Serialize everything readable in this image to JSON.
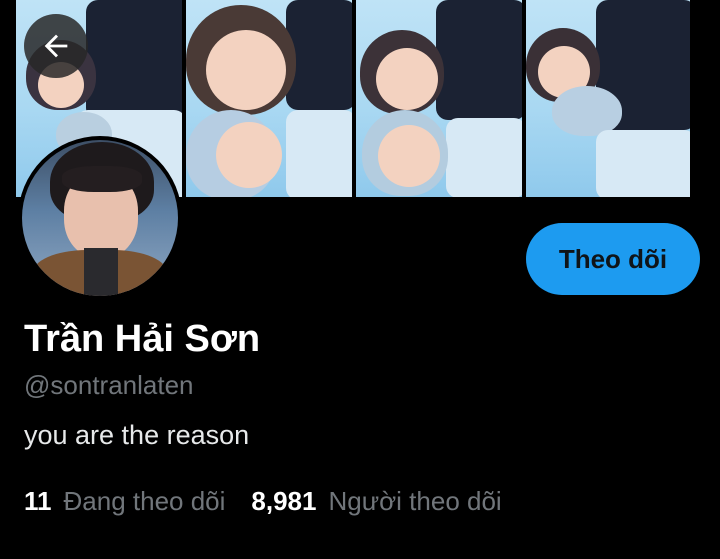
{
  "profile": {
    "name": "Trần Hải Sơn",
    "handle": "@sontranlaten",
    "bio": "you are the reason",
    "follow_label": "Theo dõi",
    "following_count": "11",
    "following_label": "Đang theo dõi",
    "followers_count": "8,981",
    "followers_label": "Người theo dõi"
  },
  "icons": {
    "back": "arrow-left-icon"
  },
  "colors": {
    "background": "#000000",
    "accent": "#1d9bf0",
    "secondary_text": "#71767b",
    "primary_text": "#ffffff"
  }
}
